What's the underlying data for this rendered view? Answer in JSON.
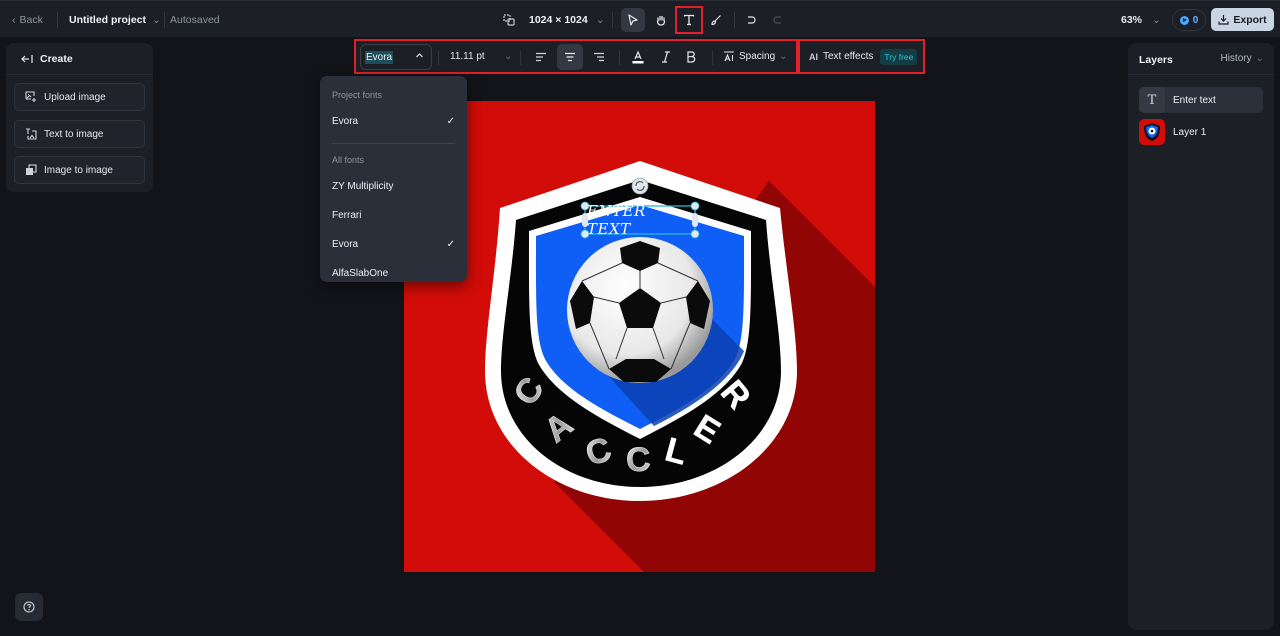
{
  "topbar": {
    "back_label": "Back",
    "project_title": "Untitled project",
    "save_status": "Autosaved",
    "canvas_size": "1024 × 1024",
    "tools": [
      {
        "name": "select",
        "icon": "pointer-icon",
        "active": true
      },
      {
        "name": "hand",
        "icon": "hand-icon",
        "active": false
      },
      {
        "name": "text",
        "icon": "text-tool-icon",
        "active": false,
        "highlighted": true
      },
      {
        "name": "brush",
        "icon": "brush-icon",
        "active": false
      }
    ],
    "undo_icon": "undo-icon",
    "redo_icon": "redo-icon",
    "zoom_level": "63%",
    "credits": "0",
    "export_label": "Export"
  },
  "text_toolbar": {
    "font": "Evora",
    "font_size": "11.11 pt",
    "align_options": [
      "left",
      "center",
      "right"
    ],
    "align_selected": "center",
    "spacing_label": "Spacing",
    "effects_icon_label": "AI",
    "effects_label": "Text effects",
    "effects_badge": "Try free"
  },
  "font_dropdown": {
    "project_section": "Project fonts",
    "project_fonts": [
      {
        "name": "Evora",
        "selected": true
      }
    ],
    "all_section": "All fonts",
    "all_fonts": [
      {
        "name": "ZY Multiplicity",
        "selected": false
      },
      {
        "name": "Ferrari",
        "selected": false
      },
      {
        "name": "Evora",
        "selected": true
      },
      {
        "name": "AlfaSlabOne",
        "selected": false
      }
    ]
  },
  "create_panel": {
    "title": "Create",
    "buttons": [
      {
        "label": "Upload image",
        "icon": "upload-image-icon"
      },
      {
        "label": "Text to image",
        "icon": "text-to-image-icon"
      },
      {
        "label": "Image to image",
        "icon": "image-to-image-icon"
      }
    ]
  },
  "canvas": {
    "text_layer": "Enter text",
    "logo_wordmark": "CACCLER",
    "colors": {
      "background": "#d20c08",
      "shield_blue": "#0f5ef5",
      "shield_black": "#050505",
      "selection": "#29b6d6"
    }
  },
  "layers_panel": {
    "title": "Layers",
    "history_label": "History",
    "layers": [
      {
        "name": "Enter text",
        "type": "text",
        "selected": true
      },
      {
        "name": "Layer 1",
        "type": "image",
        "selected": false
      }
    ]
  }
}
